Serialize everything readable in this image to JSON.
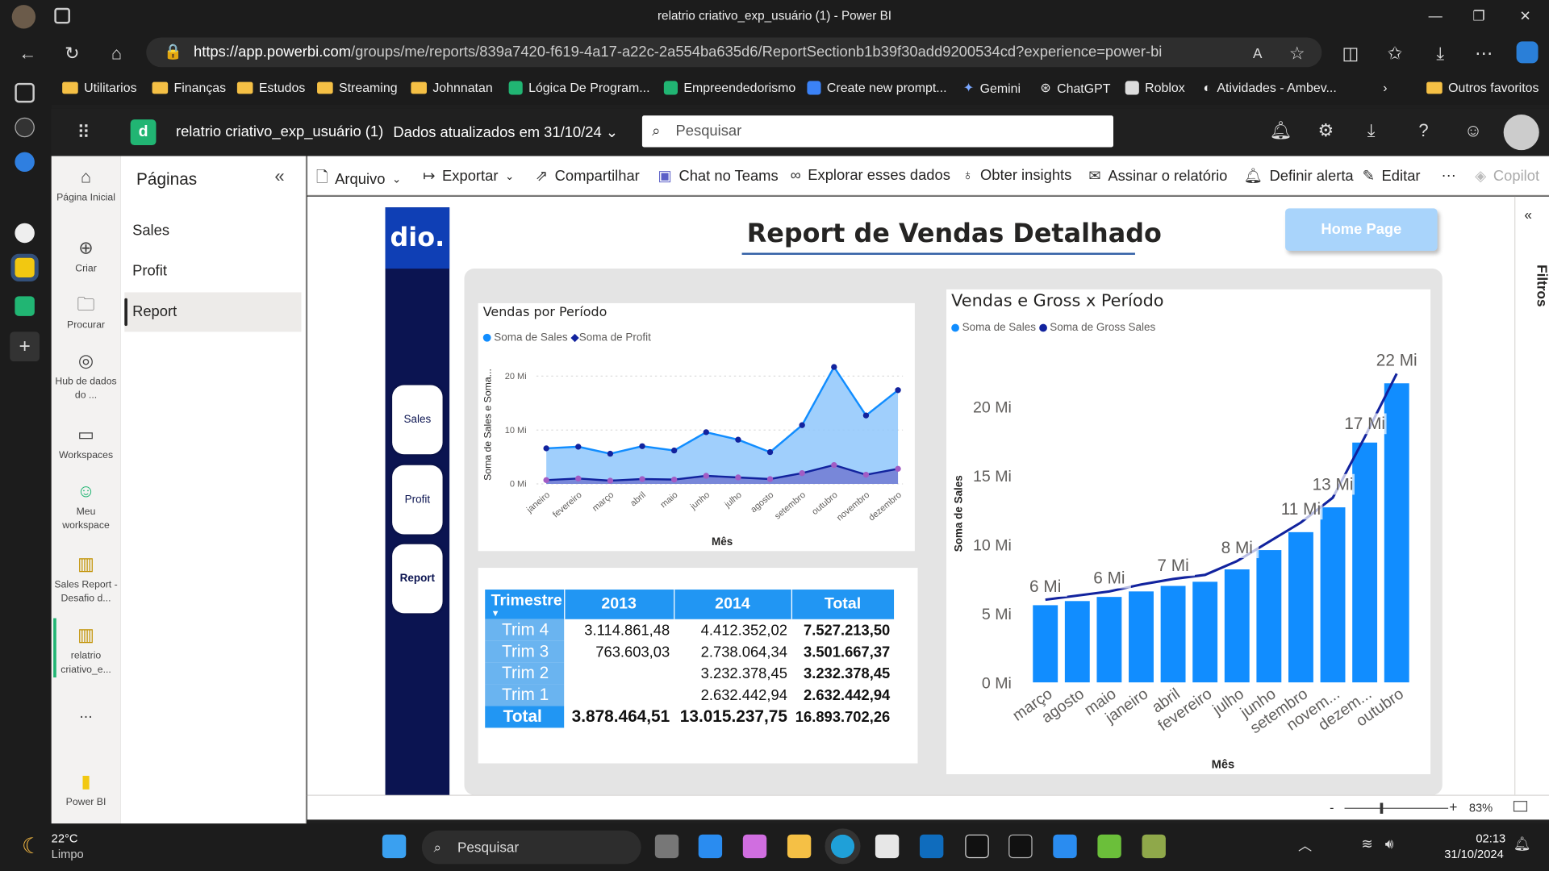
{
  "browser": {
    "window_title": "relatrio criativo_exp_usuário (1) - Power BI",
    "url_host": "https://app.powerbi.com",
    "url_path": "/groups/me/reports/839a7420-f619-4a17-a22c-2a554ba635d6/ReportSectionb1b39f30add9200534cd?experience=power-bi",
    "favorites": [
      "Utilitarios",
      "Finanças",
      "Estudos",
      "Streaming",
      "Johnnatan",
      "Lógica De Program...",
      "Empreendedorismo",
      "Create new prompt...",
      "Gemini",
      "ChatGPT",
      "Roblox",
      "Atividades - Ambev...",
      "Outros favoritos"
    ]
  },
  "header": {
    "report_name": "relatrio criativo_exp_usuário (1)",
    "updated": "Dados atualizados em 31/10/24",
    "search_placeholder": "Pesquisar"
  },
  "nav": {
    "home": "Página Inicial",
    "create": "Criar",
    "browse": "Procurar",
    "datahub": "Hub de dados do ...",
    "workspaces": "Workspaces",
    "myws": "Meu workspace",
    "recent1": "Sales Report - Desafio d...",
    "recent2": "relatrio criativo_e...",
    "more": "...",
    "powerbi": "Power BI"
  },
  "pages_pane": {
    "title": "Páginas",
    "pages": [
      "Sales",
      "Profit",
      "Report"
    ],
    "active": "Report"
  },
  "toolbar": {
    "arquivo": "Arquivo",
    "exportar": "Exportar",
    "compartilhar": "Compartilhar",
    "teams": "Chat no Teams",
    "explorar": "Explorar esses dados",
    "insights": "Obter insights",
    "assinar": "Assinar o relatório",
    "alerta": "Definir alerta",
    "editar": "Editar",
    "more": "···",
    "copilot": "Copilot"
  },
  "filters_label": "Filtros",
  "zoom": "83%",
  "report": {
    "logo": "dio.",
    "title": "Report de Vendas Detalhado",
    "home_button": "Home Page",
    "side_buttons": [
      "Sales",
      "Profit",
      "Report"
    ]
  },
  "chart1": {
    "title": "Vendas por Período",
    "legend": [
      "Soma de  Sales",
      "Soma de Profit"
    ],
    "ylabel": "Soma de Sales e Soma...",
    "xlabel": "Mês",
    "ticks": [
      "0 Mi",
      "10 Mi",
      "20 Mi"
    ]
  },
  "chart2": {
    "title": "Vendas e Gross x Período",
    "legend": [
      "Soma de  Sales",
      "Soma de Gross Sales"
    ],
    "ylabel": "Soma de Sales",
    "xlabel": "Mês",
    "ticks": [
      "0 Mi",
      "5 Mi",
      "10 Mi",
      "15 Mi",
      "20 Mi"
    ]
  },
  "chart_data": [
    {
      "type": "area",
      "title": "Vendas por Período",
      "categories": [
        "janeiro",
        "fevereiro",
        "março",
        "abril",
        "maio",
        "junho",
        "julho",
        "agosto",
        "setembro",
        "outubro",
        "novembro",
        "dezembro"
      ],
      "series": [
        {
          "name": "Soma de  Sales",
          "color": "#118dff",
          "values": [
            6.6,
            6.9,
            5.6,
            7.0,
            6.2,
            9.6,
            8.2,
            5.9,
            10.9,
            21.7,
            12.7,
            17.4
          ]
        },
        {
          "name": "Soma de Profit",
          "color": "#12239e",
          "values": [
            0.7,
            1.0,
            0.6,
            0.9,
            0.8,
            1.5,
            1.2,
            0.9,
            2.0,
            3.5,
            1.7,
            2.8
          ]
        }
      ],
      "xlabel": "Mês",
      "ylabel": "Soma de Sales e Soma...",
      "ylim": [
        0,
        22
      ],
      "grid": true,
      "legend_position": "top-left"
    },
    {
      "type": "bar",
      "title": "Vendas e Gross x Período",
      "categories": [
        "março",
        "agosto",
        "maio",
        "janeiro",
        "abril",
        "fevereiro",
        "julho",
        "junho",
        "setembro",
        "novem...",
        "dezem...",
        "outubro"
      ],
      "series": [
        {
          "name": "Soma de  Sales",
          "color": "#118dff",
          "values": [
            5.6,
            5.9,
            6.2,
            6.6,
            7.0,
            7.3,
            8.2,
            9.6,
            10.9,
            12.7,
            17.4,
            21.7
          ]
        },
        {
          "name": "Soma de Gross Sales",
          "type": "line",
          "color": "#12239e",
          "values": [
            6.0,
            6.3,
            6.6,
            7.1,
            7.5,
            7.8,
            8.8,
            10.2,
            11.6,
            13.4,
            17.8,
            22.4
          ]
        }
      ],
      "data_labels": [
        "6 Mi",
        "",
        "6 Mi",
        "",
        "7 Mi",
        "",
        "8 Mi",
        "",
        "11 Mi",
        "13 Mi",
        "17 Mi",
        "22 Mi"
      ],
      "xlabel": "Mês",
      "ylabel": "Soma de Sales",
      "ylim": [
        0,
        23
      ],
      "grid": false,
      "legend_position": "top-left"
    }
  ],
  "matrix": {
    "headers": [
      "Trimestre",
      "2013",
      "2014",
      "Total"
    ],
    "rows": [
      {
        "label": "Trim 4",
        "y2013": "3.114.861,48",
        "y2014": "4.412.352,02",
        "total": "7.527.213,50"
      },
      {
        "label": "Trim 3",
        "y2013": "763.603,03",
        "y2014": "2.738.064,34",
        "total": "3.501.667,37"
      },
      {
        "label": "Trim 2",
        "y2013": "",
        "y2014": "3.232.378,45",
        "total": "3.232.378,45"
      },
      {
        "label": "Trim 1",
        "y2013": "",
        "y2014": "2.632.442,94",
        "total": "2.632.442,94"
      }
    ],
    "total": {
      "label": "Total",
      "y2013": "3.878.464,51",
      "y2014": "13.015.237,75",
      "total": "16.893.702,26"
    }
  },
  "taskbar": {
    "temp": "22°C",
    "weather": "Limpo",
    "search": "Pesquisar",
    "time": "02:13",
    "date": "31/10/2024"
  },
  "colors": {
    "sales": "#118dff",
    "profit": "#12239e",
    "report_side": "#0b1451",
    "home_button": "#a9d4fb",
    "table_header": "#2196f3"
  }
}
